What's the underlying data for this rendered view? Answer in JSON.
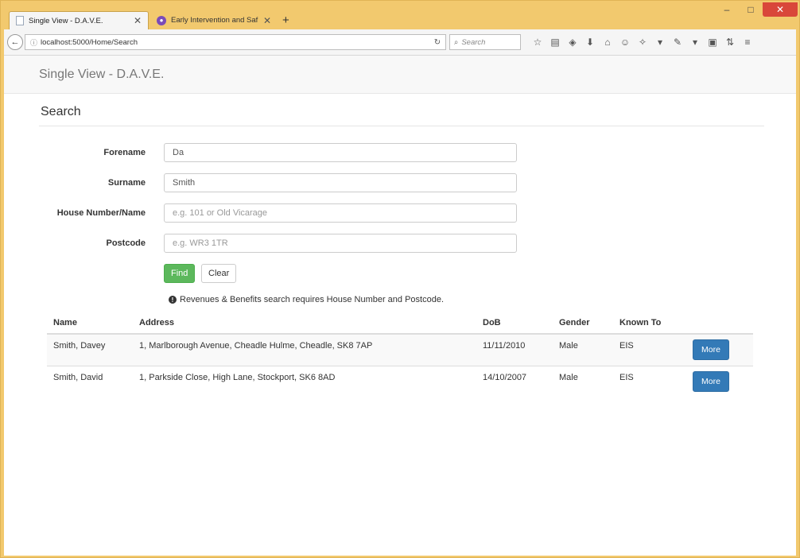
{
  "browser": {
    "tabs": [
      {
        "title": "Single View - D.A.V.E.",
        "active": true
      },
      {
        "title": "Early Intervention and Saf...",
        "active": false
      }
    ],
    "new_tab": "+",
    "url": "localhost:5000/Home/Search",
    "search_placeholder": "Search"
  },
  "app": {
    "brand": "Single View - D.A.V.E.",
    "page_title": "Search"
  },
  "form": {
    "forename": {
      "label": "Forename",
      "value": "Da",
      "placeholder": ""
    },
    "surname": {
      "label": "Surname",
      "value": "Smith",
      "placeholder": ""
    },
    "house": {
      "label": "House Number/Name",
      "value": "",
      "placeholder": "e.g. 101 or Old Vicarage"
    },
    "postcode": {
      "label": "Postcode",
      "value": "",
      "placeholder": "e.g. WR3 1TR"
    },
    "find_label": "Find",
    "clear_label": "Clear",
    "hint": "Revenues & Benefits search requires House Number and Postcode."
  },
  "results": {
    "headers": [
      "Name",
      "Address",
      "DoB",
      "Gender",
      "Known To",
      ""
    ],
    "rows": [
      {
        "name": "Smith, Davey",
        "address": "1, Marlborough Avenue, Cheadle Hulme, Cheadle, SK8 7AP",
        "dob": "11/11/2010",
        "gender": "Male",
        "known_to": "EIS",
        "action": "More"
      },
      {
        "name": "Smith, David",
        "address": "1, Parkside Close, High Lane, Stockport, SK6 8AD",
        "dob": "14/10/2007",
        "gender": "Male",
        "known_to": "EIS",
        "action": "More"
      }
    ]
  },
  "colors": {
    "window_frame": "#f2c96e",
    "find_button": "#5cb85c",
    "more_button": "#337ab7"
  }
}
